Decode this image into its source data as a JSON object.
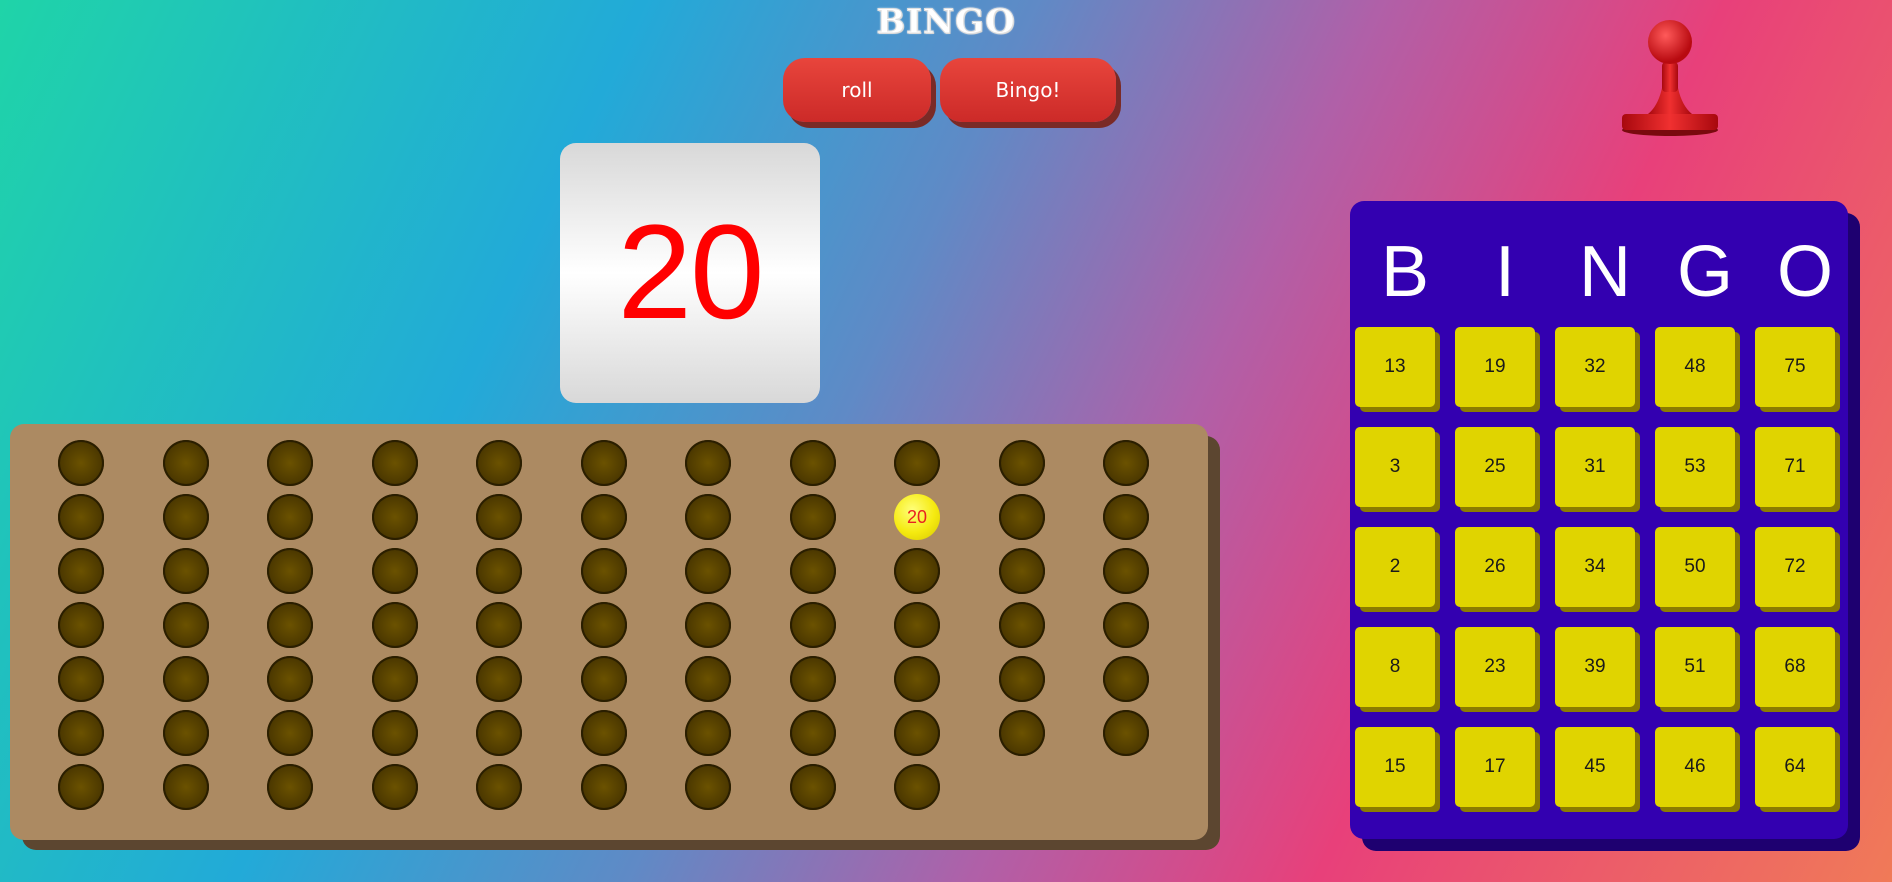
{
  "title": "BINGO",
  "buttons": {
    "roll": "roll",
    "bingo": "Bingo!"
  },
  "current_number": "20",
  "called_numbers": [
    "20"
  ],
  "board": {
    "columns": 11,
    "rows": 7,
    "total_holes": 75,
    "called_index": 19,
    "called_label": "20"
  },
  "card": {
    "headers": [
      "B",
      "I",
      "N",
      "G",
      "O"
    ],
    "rows": [
      [
        "13",
        "19",
        "32",
        "48",
        "75"
      ],
      [
        "3",
        "25",
        "31",
        "53",
        "71"
      ],
      [
        "2",
        "26",
        "34",
        "50",
        "72"
      ],
      [
        "8",
        "23",
        "39",
        "51",
        "68"
      ],
      [
        "15",
        "17",
        "45",
        "46",
        "64"
      ]
    ]
  },
  "colors": {
    "button": "#e03a34",
    "number": "#ff0000",
    "board": "#ac8a62",
    "card": "#3300b0",
    "cell": "#e0d400",
    "called_ball": "#f5ea10"
  },
  "icons": {
    "stamp": "bingo-stamp-icon"
  }
}
